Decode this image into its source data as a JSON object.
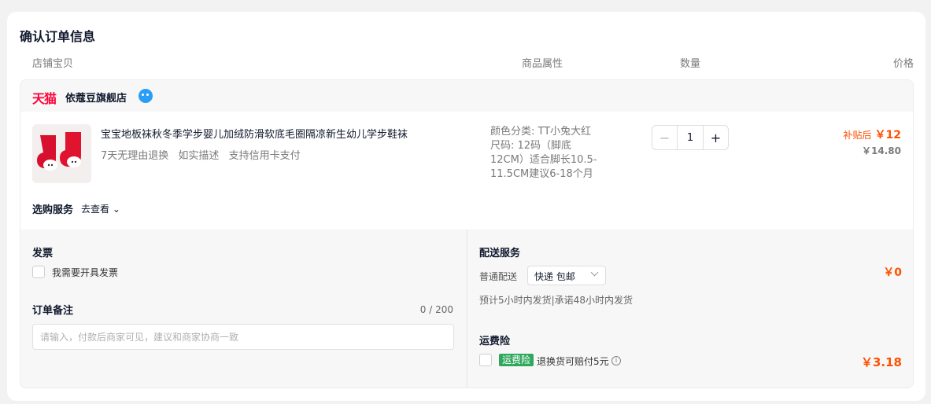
{
  "page_title": "确认订单信息",
  "columns": {
    "store": "店铺宝贝",
    "attributes": "商品属性",
    "quantity": "数量",
    "price": "价格"
  },
  "shop": {
    "badge": "天猫",
    "name": "依蔻豆旗舰店"
  },
  "item": {
    "title": "宝宝地板袜秋冬季学步婴儿加绒防滑软底毛圈隔凉新生幼儿学步鞋袜",
    "tags": [
      "7天无理由退换",
      "如实描述",
      "支持信用卡支付"
    ],
    "attr_lines": [
      "颜色分类: TT小兔大红",
      "尺码: 12码（脚底",
      "12CM）适合脚长10.5-",
      "11.5CM建议6-18个月"
    ],
    "quantity": "1",
    "subsidy_label": "补贴后",
    "subsidy_price": "￥12",
    "original_price": "￥14.80"
  },
  "stepper": {
    "minus": "−",
    "plus": "+"
  },
  "service": {
    "label": "选购服务",
    "link": "去查看 ⌄"
  },
  "invoice": {
    "title": "发票",
    "checkbox_label": "我需要开具发票"
  },
  "remark": {
    "title": "订单备注",
    "counter": "0 / 200",
    "placeholder": "请输入，付款后商家可见，建议和商家协商一致"
  },
  "delivery": {
    "title": "配送服务",
    "type_label": "普通配送",
    "select_value": "快递 包邮",
    "note": "预计5小时内发货|承诺48小时内发货",
    "fee": "￥0"
  },
  "insurance": {
    "title": "运费险",
    "badge": "运费险",
    "desc": "退换货可赔付5元",
    "info": "i",
    "fee": "￥3.18"
  },
  "colors": {
    "tmall_red": "#ff0036",
    "price_orange": "#ff5000",
    "insurance_green": "#2fa85d"
  }
}
